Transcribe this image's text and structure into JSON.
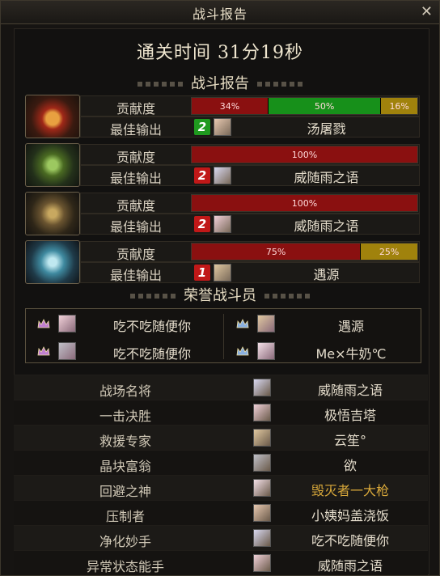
{
  "window": {
    "title": "战斗报告",
    "close_label": "✕"
  },
  "clear_time": "通关时间   31分19秒",
  "sections": {
    "report": "战斗报告",
    "honor": "荣誉战斗员"
  },
  "labels": {
    "contribution": "贡献度",
    "best_output": "最佳输出"
  },
  "bosses": [
    {
      "icon": "flame-boss-icon",
      "segments": [
        {
          "text": "34%",
          "pct": 34,
          "color": "#8a1010"
        },
        {
          "text": "50%",
          "pct": 50,
          "color": "#17901a"
        },
        {
          "text": "16%",
          "pct": 16,
          "color": "#a0820c"
        }
      ],
      "rank": "2",
      "rank_color": "#1f9a1f",
      "player": "汤屠戮"
    },
    {
      "icon": "poison-boss-icon",
      "segments": [
        {
          "text": "100%",
          "pct": 100,
          "color": "#8a1010"
        }
      ],
      "rank": "2",
      "rank_color": "#c01818",
      "player": "威随雨之语"
    },
    {
      "icon": "shadow-boss-icon",
      "segments": [
        {
          "text": "100%",
          "pct": 100,
          "color": "#8a1010"
        }
      ],
      "rank": "2",
      "rank_color": "#c01818",
      "player": "威随雨之语"
    },
    {
      "icon": "ice-boss-icon",
      "segments": [
        {
          "text": "75%",
          "pct": 75,
          "color": "#8a1010"
        },
        {
          "text": "25%",
          "pct": 25,
          "color": "#a0820c"
        }
      ],
      "rank": "1",
      "rank_color": "#c01818",
      "player": "遇源"
    }
  ],
  "honor": [
    {
      "name": "吃不吃随便你"
    },
    {
      "name": "遇源"
    },
    {
      "name": "吃不吃随便你"
    },
    {
      "name": "Me×牛奶℃"
    }
  ],
  "awards": [
    {
      "title": "战场名将",
      "player": "威随雨之语",
      "color": "#e4dccb"
    },
    {
      "title": "一击决胜",
      "player": "极悟吉塔",
      "color": "#e4dccb"
    },
    {
      "title": "救援专家",
      "player": "云笙°",
      "color": "#e4dccb"
    },
    {
      "title": "晶块富翁",
      "player": "欲",
      "color": "#e4dccb"
    },
    {
      "title": "回避之神",
      "player": "毁灭者一大枪",
      "color": "#d8a83a"
    },
    {
      "title": "压制者",
      "player": "小姨妈盖浇饭",
      "color": "#e4dccb"
    },
    {
      "title": "净化妙手",
      "player": "吃不吃随便你",
      "color": "#e4dccb"
    },
    {
      "title": "异常状态能手",
      "player": "威随雨之语",
      "color": "#e4dccb"
    }
  ]
}
